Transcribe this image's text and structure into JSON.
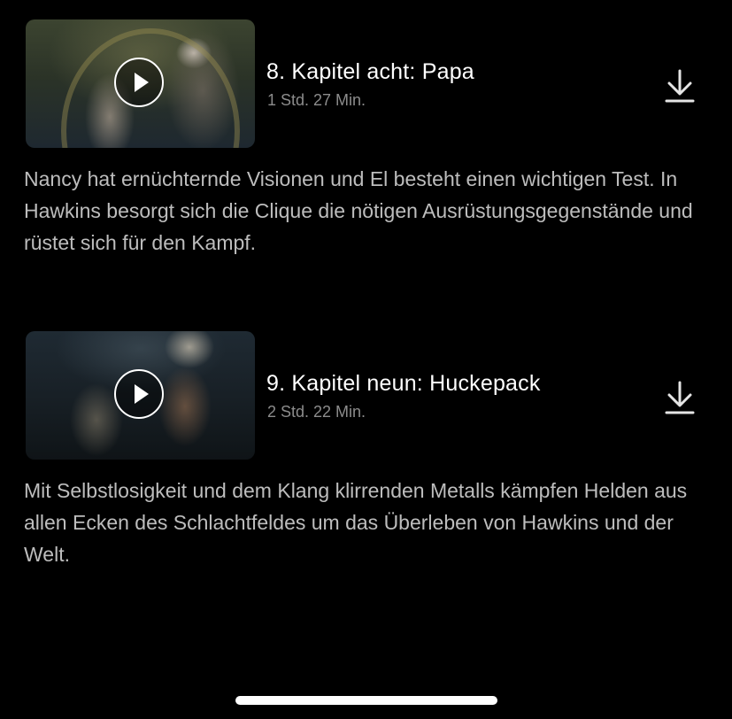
{
  "episodes": [
    {
      "title": "8. Kapitel acht: Papa",
      "duration": "1 Std. 27 Min.",
      "description": "Nancy hat ernüchternde Visionen und El besteht einen wichtigen Test. In Hawkins besorgt sich die Clique die nötigen Ausrüstungsgegenstände und rüstet sich für den Kampf.",
      "thumbnail_icon": "play-icon",
      "action_icon": "download-icon"
    },
    {
      "title": "9. Kapitel neun: Huckepack",
      "duration": "2 Std. 22 Min.",
      "description": "Mit Selbstlosigkeit und dem Klang klirrenden Metalls kämpfen Helden aus allen Ecken des Schlachtfeldes um das Überleben von Hawkins und der Welt.",
      "thumbnail_icon": "play-icon",
      "action_icon": "download-icon"
    }
  ],
  "colors": {
    "background": "#000000",
    "title": "#ffffff",
    "duration": "#8c8c8c",
    "description": "#bdbdbd",
    "icon": "#e5e5e5"
  }
}
